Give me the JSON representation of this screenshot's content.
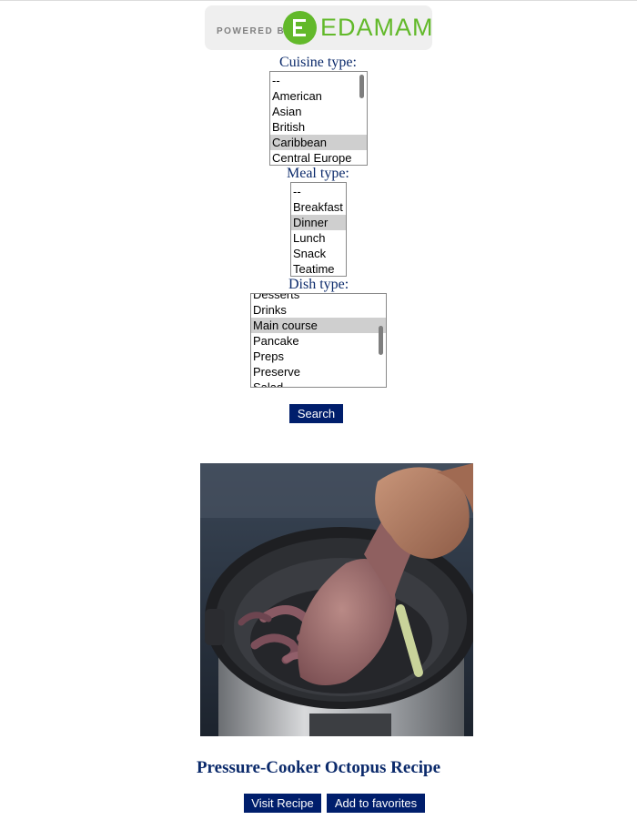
{
  "logo": {
    "powered_by": "POWERED BY",
    "brand": "EDAMAM",
    "brand_color": "#62b92a"
  },
  "cuisine": {
    "label": "Cuisine type:",
    "options": [
      "--",
      "American",
      "Asian",
      "British",
      "Caribbean",
      "Central Europe"
    ],
    "selected": "Caribbean"
  },
  "meal": {
    "label": "Meal type:",
    "options": [
      "--",
      "Breakfast",
      "Dinner",
      "Lunch",
      "Snack",
      "Teatime"
    ],
    "selected": "Dinner"
  },
  "dish": {
    "label": "Dish type:",
    "options": [
      "Desserts",
      "Drinks",
      "Main course",
      "Pancake",
      "Preps",
      "Preserve",
      "Salad"
    ],
    "selected": "Main course"
  },
  "search_button": "Search",
  "recipe": {
    "title": "Pressure-Cooker Octopus Recipe",
    "visit_label": "Visit Recipe",
    "favorite_label": "Add to favorites"
  },
  "colors": {
    "accent": "#001e6c",
    "label_text": "#0b2a6b",
    "selected_option": "#cfcfcf"
  }
}
